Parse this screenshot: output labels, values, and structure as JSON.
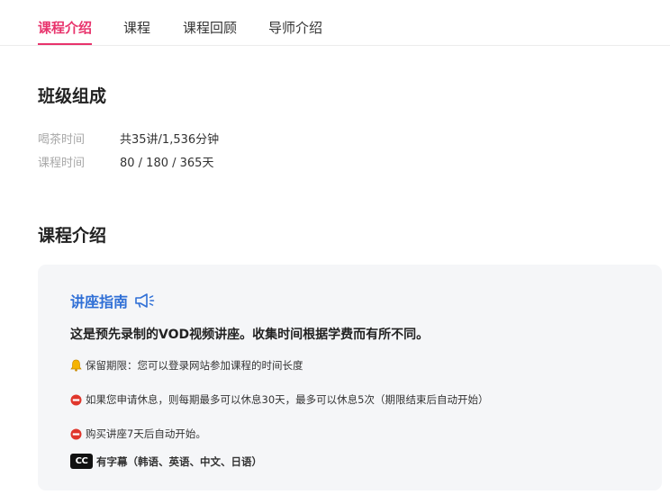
{
  "tabs": [
    {
      "label": "课程介绍",
      "active": true
    },
    {
      "label": "课程",
      "active": false
    },
    {
      "label": "课程回顾",
      "active": false
    },
    {
      "label": "导师介绍",
      "active": false
    }
  ],
  "class_section": {
    "title": "班级组成",
    "rows": [
      {
        "label": "喝茶时间",
        "value": "共35讲/1,536分钟"
      },
      {
        "label": "课程时间",
        "value": "80 / 180 / 365天"
      }
    ]
  },
  "intro_section": {
    "title": "课程介绍"
  },
  "guide": {
    "title": "讲座指南",
    "title_icon": "megaphone-icon",
    "lead": "这是预先录制的VOD视频讲座。收集时间根据学费而有所不同。",
    "items": [
      {
        "icon": "bell-icon",
        "text": "保留期限：您可以登录网站参加课程的时间长度"
      },
      {
        "icon": "no-entry-icon",
        "text": "如果您申请休息，则每期最多可以休息30天，最多可以休息5次（期限结束后自动开始）"
      },
      {
        "icon": "no-entry-icon",
        "text": "购买讲座7天后自动开始。"
      },
      {
        "icon": "cc-icon",
        "badge": "CC",
        "text": "有字幕（韩语、英语、中文、日语）"
      }
    ]
  },
  "colors": {
    "accent": "#e8336c",
    "guide_title": "#2f6fd6",
    "guide_bg": "#f5f6f8"
  }
}
